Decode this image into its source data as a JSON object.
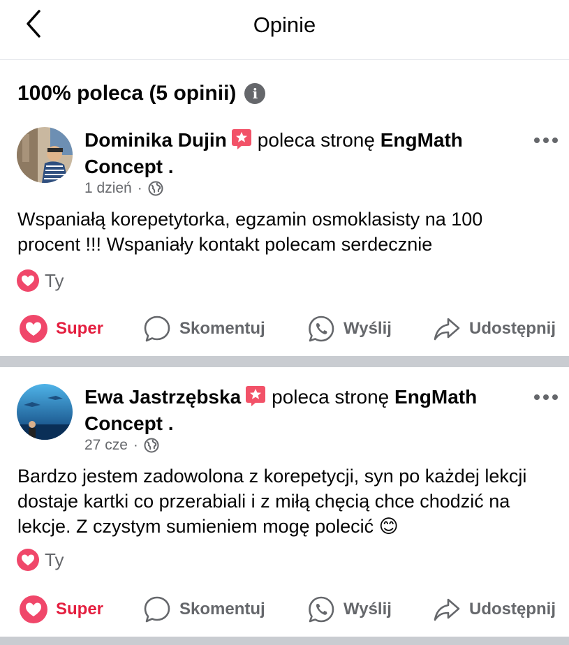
{
  "header": {
    "title": "Opinie"
  },
  "summary": {
    "text": "100% poleca (5 opinii)"
  },
  "reviews": [
    {
      "author": "Dominika Dujin",
      "verb": "poleca stronę",
      "page_name": "EngMath Concept",
      "page_suffix": " .",
      "time": "1 dzień",
      "audience_icon": "globe-icon",
      "text": "Wspaniałą korepetytorka, egzamin osmoklasisty na 100 procent !!! Wspaniały kontakt polecam serdecznie",
      "reactor": "Ty"
    },
    {
      "author": "Ewa Jastrzębska",
      "verb": "poleca stronę",
      "page_name": "EngMath Concept",
      "page_suffix": " .",
      "time": "27 cze",
      "audience_icon": "globe-icon",
      "text": "Bardzo jestem zadowolona z korepetycji, syn po każdej lekcji dostaje kartki co przerabiali i  z miłą chęcią chce chodzić na lekcje. Z czystym sumieniem mogę polecić 😊",
      "reactor": "Ty"
    }
  ],
  "actions": {
    "super": "Super",
    "comment": "Skomentuj",
    "send": "Wyślij",
    "share": "Udostępnij"
  },
  "colors": {
    "accent_red": "#e41e3f",
    "muted": "#65676b",
    "separator": "#c9ccd1"
  }
}
